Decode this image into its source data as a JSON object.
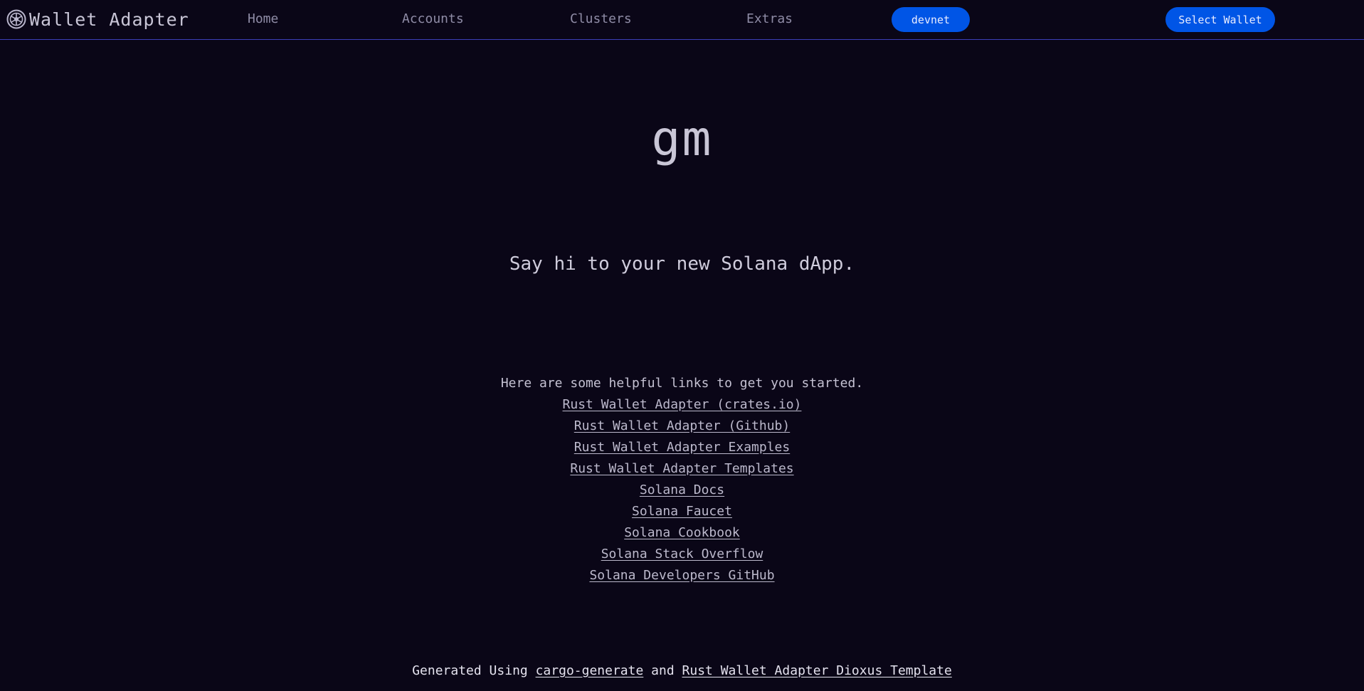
{
  "header": {
    "brand": {
      "icon": "solana-logo-icon",
      "label": "Wallet Adapter"
    },
    "nav": [
      {
        "label": "Home"
      },
      {
        "label": "Accounts"
      },
      {
        "label": "Clusters"
      },
      {
        "label": "Extras"
      }
    ],
    "cluster_button": "devnet",
    "wallet_button": "Select Wallet"
  },
  "main": {
    "title": "gm",
    "tagline": "Say hi to your new Solana dApp.",
    "links_intro": "Here are some helpful links to get you started.",
    "links": [
      {
        "label": "Rust Wallet Adapter (crates.io)"
      },
      {
        "label": "Rust Wallet Adapter (Github)"
      },
      {
        "label": "Rust Wallet Adapter Examples"
      },
      {
        "label": "Rust Wallet Adapter Templates"
      },
      {
        "label": "Solana Docs"
      },
      {
        "label": "Solana Faucet"
      },
      {
        "label": "Solana Cookbook"
      },
      {
        "label": "Solana Stack Overflow"
      },
      {
        "label": "Solana Developers GitHub"
      }
    ]
  },
  "footer": {
    "prefix": "Generated Using",
    "link1": "cargo-generate",
    "joiner": "and",
    "link2": "Rust Wallet Adapter Dioxus Template"
  },
  "colors": {
    "background": "#0a0617",
    "accent_button": "#0055e6",
    "header_border": "#3b3fb8"
  }
}
